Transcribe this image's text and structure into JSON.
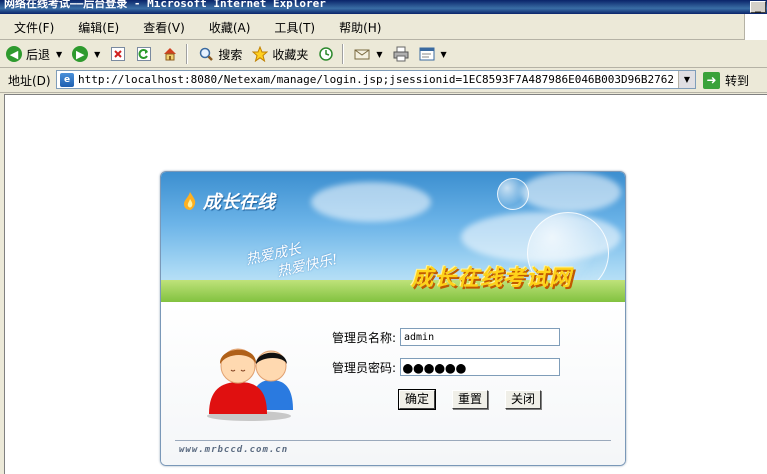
{
  "window": {
    "title": "网络在线考试——后台登录 - Microsoft Internet Explorer"
  },
  "menu": [
    {
      "label": "文件(F)"
    },
    {
      "label": "编辑(E)"
    },
    {
      "label": "查看(V)"
    },
    {
      "label": "收藏(A)"
    },
    {
      "label": "工具(T)"
    },
    {
      "label": "帮助(H)"
    }
  ],
  "toolbar": {
    "back_label": "后退",
    "search_label": "搜索",
    "favorites_label": "收藏夹"
  },
  "address": {
    "label": "地址(D)",
    "url": "http://localhost:8080/Netexam/manage/login.jsp;jsessionid=1EC8593F7A487986E046B003D96B2762",
    "go_label": "转到"
  },
  "login": {
    "logo_text": "成长在线",
    "slogan_line1": "热爱成长",
    "slogan_line2": "热爱快乐!",
    "big_title": "成长在线考试网",
    "username_label": "管理员名称:",
    "username_value": "admin",
    "password_label": "管理员密码:",
    "password_value": "●●●●●●",
    "ok_label": "确定",
    "reset_label": "重置",
    "close_label": "关闭",
    "footer_url": "www.mrbccd.com.cn"
  },
  "colors": {
    "accent_title": "#ffd21a",
    "sky": "#6cb4e8",
    "grass": "#7cbf3a"
  }
}
